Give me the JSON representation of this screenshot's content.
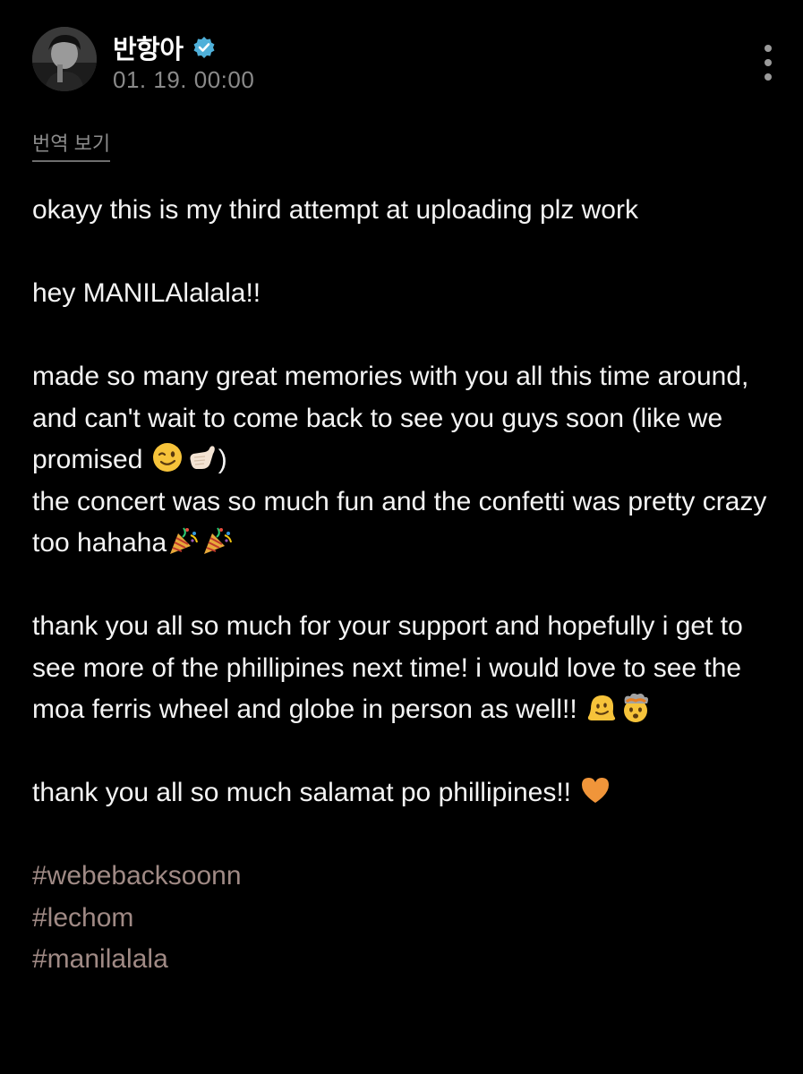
{
  "author": {
    "name": "반항아",
    "verified": true,
    "timestamp": "01. 19. 00:00"
  },
  "actions": {
    "more_icon": "more-vertical-icon",
    "translate_label": "번역 보기"
  },
  "post": {
    "line1": "okayy this is my third attempt at uploading plz work",
    "line2": "hey MANILAlalala!!",
    "para3_a": "made so many great memories with you all this time around, and can't wait to come back to see you guys soon (like we promised ",
    "para3_b": ")",
    "para3_c": "the concert was so much fun and the confetti was pretty crazy too hahaha",
    "para4": "thank you all so much for your support and hopefully i get to see more of the phillipines next time! i would love to see the moa ferris wheel and globe in person as well!! ",
    "para5": "thank you all so much salamat po phillipines!! ",
    "hashtags": [
      "#webebacksoonn",
      "#lechom",
      "#manilalala"
    ]
  },
  "emojis": [
    "winking-face",
    "call-me-hand",
    "party-popper",
    "party-popper",
    "melting-face",
    "exploding-head",
    "orange-heart"
  ],
  "colors": {
    "background": "#000000",
    "text": "#f4f4f4",
    "muted": "#8a8a8a",
    "hashtag": "#a08a85",
    "verified_badge": "#4fb0d9"
  }
}
